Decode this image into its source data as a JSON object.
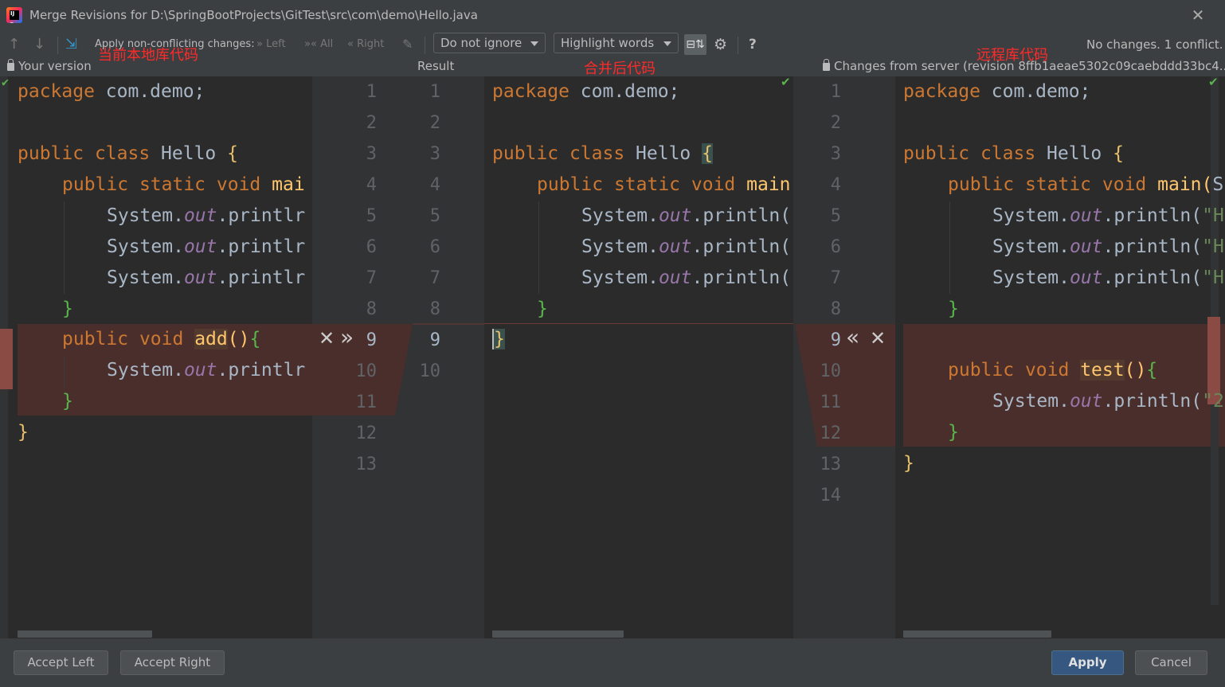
{
  "window": {
    "title": "Merge Revisions for D:\\SpringBootProjects\\GitTest\\src\\com\\demo\\Hello.java"
  },
  "toolbar": {
    "apply_nonconflicting_label": "Apply non-conflicting changes:",
    "left_label": "Left",
    "all_label": "All",
    "right_label": "Right",
    "whitespace_select": "Do not ignore",
    "highlight_select": "Highlight words",
    "help_label": "?",
    "status": "No changes. 1 conflict."
  },
  "headers": {
    "left": "Your version",
    "middle": "Result",
    "right": "Changes from server (revision 8ffb1aeae5302c09caebddd33bc4..."
  },
  "annotations": {
    "left": "当前本地库代码",
    "middle": "合并后代码",
    "right": "远程库代码"
  },
  "colors": {
    "background": "#2b2b2b",
    "gutter": "#313335",
    "conflict": "#4a2e2b",
    "keyword": "#cc7832",
    "function": "#ffc66d",
    "field": "#9876aa",
    "annotation": "#ff2a2a",
    "primary_button": "#365880"
  },
  "gutter": {
    "left_numbers": [
      "1",
      "2",
      "3",
      "4",
      "5",
      "6",
      "7",
      "8",
      "9",
      "10",
      "11",
      "12",
      "13"
    ],
    "middle_numbers": [
      "1",
      "2",
      "3",
      "4",
      "5",
      "6",
      "7",
      "8",
      "9",
      "10"
    ],
    "right_numbers": [
      "1",
      "2",
      "3",
      "4",
      "5",
      "6",
      "7",
      "8",
      "9",
      "10",
      "11",
      "12",
      "13",
      "14"
    ]
  },
  "code": {
    "pkg": "package",
    "pkg_name": " com.demo;",
    "public": "public",
    "class": " class",
    "hello": " Hello ",
    "static": " static",
    "void": " void",
    "main": " main",
    "system": "System.",
    "out": "out",
    "println": ".println",
    "add": "add",
    "test": "test",
    "parens": "()",
    "open": "{",
    "close": "}",
    "left_main_clip": " mai",
    "left_println_clip": ".printlr",
    "middle_println": ".println(",
    "right_main": " main(",
    "right_main_tail": "S",
    "right_println": ".println(",
    "right_str": "\"H",
    "right_str2": "\"2"
  },
  "buttons": {
    "accept_left": "Accept Left",
    "accept_right": "Accept Right",
    "apply": "Apply",
    "cancel": "Cancel"
  }
}
